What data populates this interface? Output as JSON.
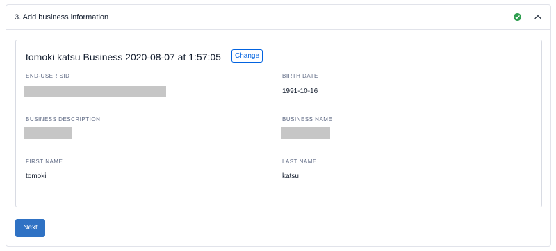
{
  "section": {
    "title": "3. Add business information",
    "status_icon": "check-circle-icon",
    "status_color": "#2e9e4f",
    "toggle_icon": "chevron-up-icon"
  },
  "card": {
    "title": "tomoki katsu Business 2020-08-07 at 1:57:05",
    "change_label": "Change",
    "fields": {
      "end_user_sid": {
        "label": "END-USER SID",
        "value_redacted": true
      },
      "birth_date": {
        "label": "BIRTH DATE",
        "value": "1991-10-16"
      },
      "business_description": {
        "label": "BUSINESS DESCRIPTION",
        "value_redacted": true
      },
      "business_name": {
        "label": "BUSINESS NAME",
        "value_redacted": true
      },
      "first_name": {
        "label": "FIRST NAME",
        "value": "tomoki"
      },
      "last_name": {
        "label": "LAST NAME",
        "value": "katsu"
      }
    }
  },
  "actions": {
    "next_label": "Next"
  },
  "colors": {
    "accent": "#0263e0",
    "primary_button": "#2f72c4",
    "redaction": "#c6c6c6"
  }
}
